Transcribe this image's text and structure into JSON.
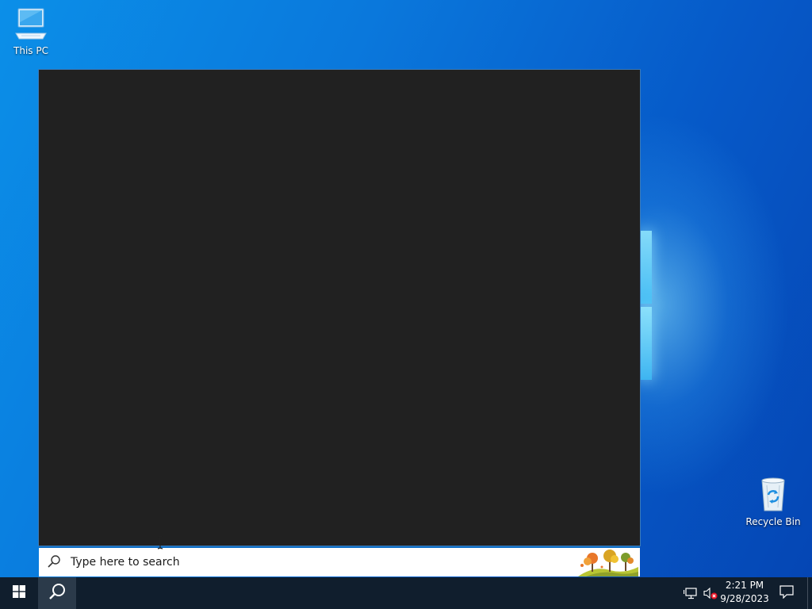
{
  "desktop": {
    "icons": [
      {
        "label": "This PC",
        "icon": "this-pc-icon"
      },
      {
        "label": "Recycle Bin",
        "icon": "recycle-bin-icon"
      }
    ]
  },
  "search": {
    "placeholder": "Type here to search",
    "value": "",
    "highlight_icon": "autumn-trees-icon"
  },
  "taskbar": {
    "start_icon": "windows-logo-icon",
    "search_icon": "search-icon",
    "tray": {
      "network_icon": "network-icon",
      "volume_icon": "volume-muted-icon",
      "time": "2:21 PM",
      "date": "9/28/2023",
      "notification_icon": "action-center-icon"
    }
  },
  "colors": {
    "taskbar": "#101e2d",
    "search_panel": "#212121",
    "accent": "#0f6fc6",
    "wallpaper": "#0a78dc"
  }
}
